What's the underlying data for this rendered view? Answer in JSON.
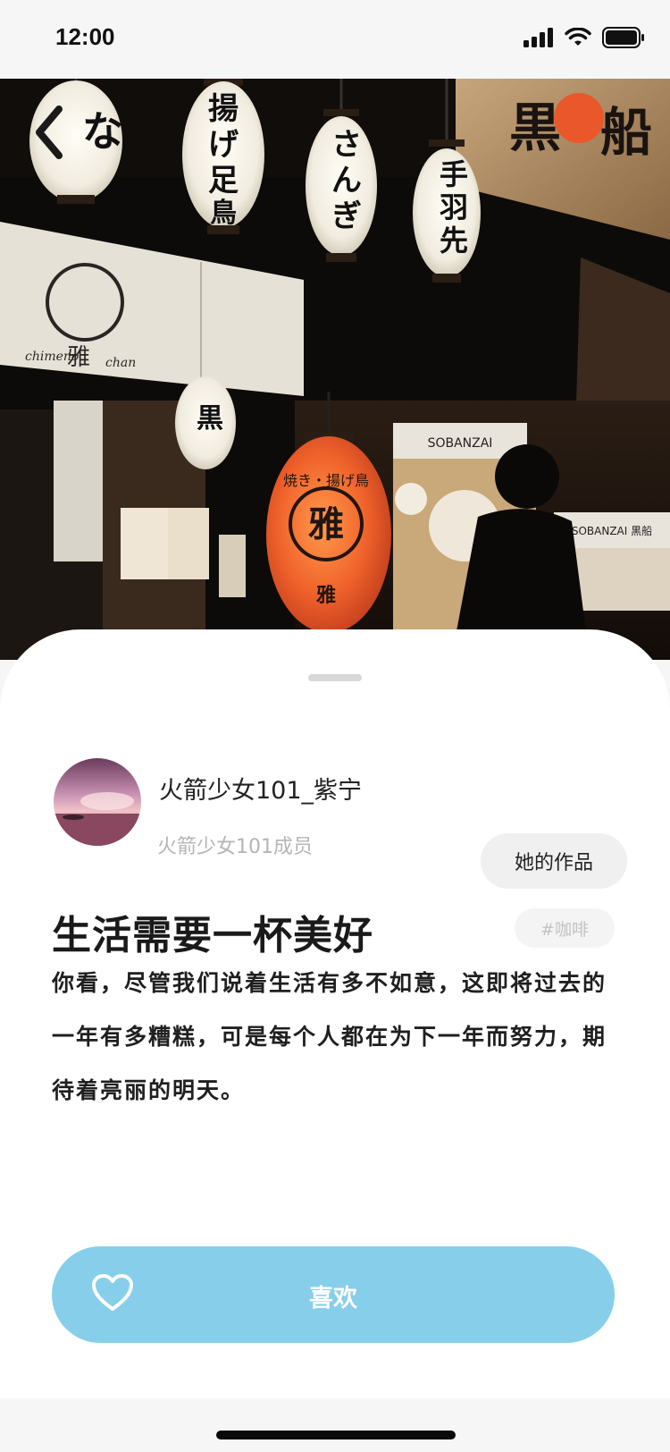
{
  "status_bar": {
    "time": "12:00"
  },
  "hero": {
    "image_description": "Night izakaya entrance with paper lanterns",
    "lantern_texts": [
      "ひな",
      "揚げ足鳥",
      "さんぎ",
      "手羽先",
      "雅"
    ],
    "signs": [
      "黒船",
      "SOBANZAI"
    ]
  },
  "author": {
    "name": "火箭少女101_紫宁",
    "group": "火箭少女101成员",
    "works_button_label": "她的作品"
  },
  "post": {
    "title": "生活需要一杯美好",
    "tag": "#咖啡",
    "body": "你看，尽管我们说着生活有多不如意，这即将过去的一年有多糟糕，可是每个人都在为下一年而努力，期待着亮丽的明天。"
  },
  "actions": {
    "like_label": "喜欢"
  },
  "icons": {
    "back": "chevron-left-icon",
    "like": "heart-outline-icon",
    "signal": "signal-icon",
    "wifi": "wifi-icon",
    "battery": "battery-icon"
  },
  "colors": {
    "accent": "#87ceea",
    "lantern_red": "#e8502a",
    "sheet": "#ffffff"
  }
}
